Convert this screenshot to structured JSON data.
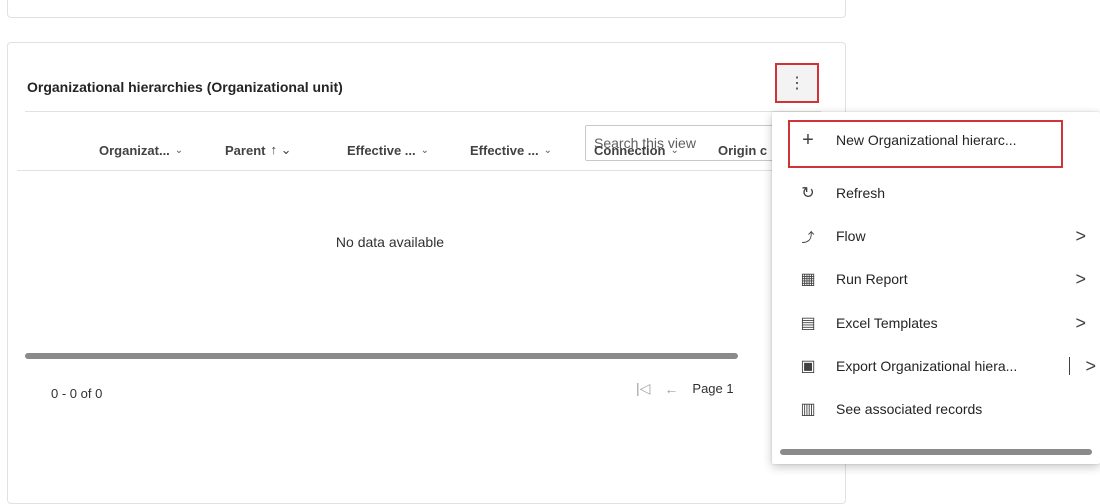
{
  "card": {
    "title": "Organizational hierarchies (Organizational unit)",
    "more_label": "⋮"
  },
  "search": {
    "placeholder": "Search this view"
  },
  "columns": [
    {
      "label": "Organizat...",
      "indicator": "⌄"
    },
    {
      "label": "Parent",
      "indicator": "↑ ⌄"
    },
    {
      "label": "Effective ...",
      "indicator": "⌄"
    },
    {
      "label": "Effective ...",
      "indicator": "⌄"
    },
    {
      "label": "Connection",
      "indicator": "⌄"
    },
    {
      "label": "Origin c",
      "indicator": ""
    }
  ],
  "empty_message": "No data available",
  "footer": {
    "count": "0 - 0 of 0",
    "first_icon": "|◁",
    "prev_icon": "←",
    "page_label": "Page 1"
  },
  "menu": {
    "items": [
      {
        "label": "New Organizational hierarc...",
        "icon": "plus-icon",
        "glyph": "+",
        "submenu": false
      },
      {
        "label": "Refresh",
        "icon": "refresh-icon",
        "glyph": "↻",
        "submenu": false
      },
      {
        "label": "Flow",
        "icon": "flow-icon",
        "glyph": "⤴",
        "submenu": true
      },
      {
        "label": "Run Report",
        "icon": "report-icon",
        "glyph": "▦",
        "submenu": true
      },
      {
        "label": "Excel Templates",
        "icon": "excel-template-icon",
        "glyph": "▤",
        "submenu": true
      },
      {
        "label": "Export Organizational hiera...",
        "icon": "excel-export-icon",
        "glyph": "▣",
        "submenu": true
      },
      {
        "label": "See associated records",
        "icon": "associated-records-icon",
        "glyph": "▥",
        "submenu": false
      }
    ],
    "chevron": ">"
  },
  "colors": {
    "highlight": "#d13438",
    "divider": "#e1e1e1"
  }
}
